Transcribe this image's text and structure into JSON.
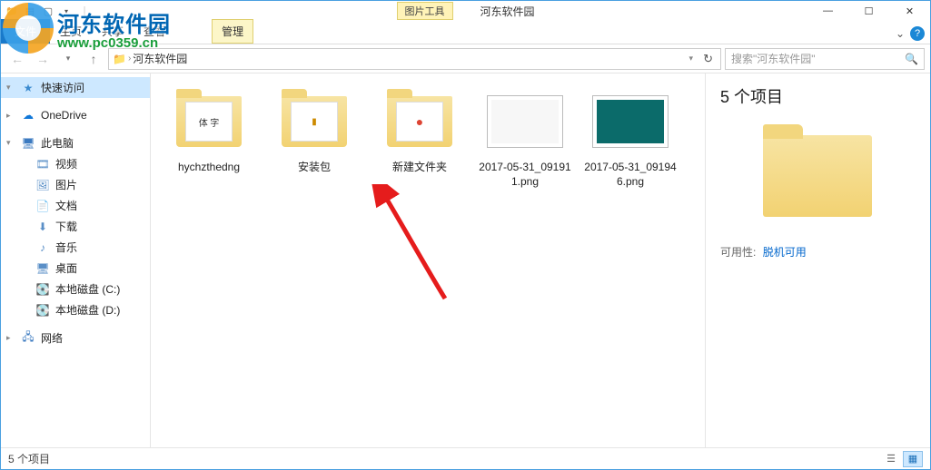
{
  "window": {
    "tab_context_label": "图片工具",
    "title": "河东软件园",
    "min": "—",
    "max": "☐",
    "close": "✕"
  },
  "ribbon": {
    "file": "文件",
    "home": "主页",
    "share": "共享",
    "view": "查看",
    "manage": "管理",
    "expand": "⌄",
    "help": "?"
  },
  "address": {
    "root_icon": "📁",
    "current": "河东软件园",
    "refresh": "↻",
    "search_placeholder": "搜索\"河东软件园\"",
    "search_icon": "🔍"
  },
  "sidebar": {
    "quick": "快速访问",
    "onedrive": "OneDrive",
    "thispc": "此电脑",
    "videos": "视频",
    "pictures": "图片",
    "documents": "文档",
    "downloads": "下载",
    "music": "音乐",
    "desktop": "桌面",
    "drive_c": "本地磁盘 (C:)",
    "drive_d": "本地磁盘 (D:)",
    "network": "网络"
  },
  "items": [
    {
      "name": "hychzthedng",
      "type": "folder",
      "preview": "体 字"
    },
    {
      "name": "安装包",
      "type": "folder",
      "preview": "▮"
    },
    {
      "name": "新建文件夹",
      "type": "folder",
      "preview": "●"
    },
    {
      "name": "2017-05-31_091911.png",
      "type": "image_light"
    },
    {
      "name": "2017-05-31_091946.png",
      "type": "image_dark"
    }
  ],
  "details": {
    "count_title": "5 个项目",
    "avail_label": "可用性:",
    "avail_value": "脱机可用"
  },
  "status": {
    "count": "5 个项目"
  },
  "watermark": {
    "line1": "河东软件园",
    "line2": "www.pc0359.cn"
  }
}
